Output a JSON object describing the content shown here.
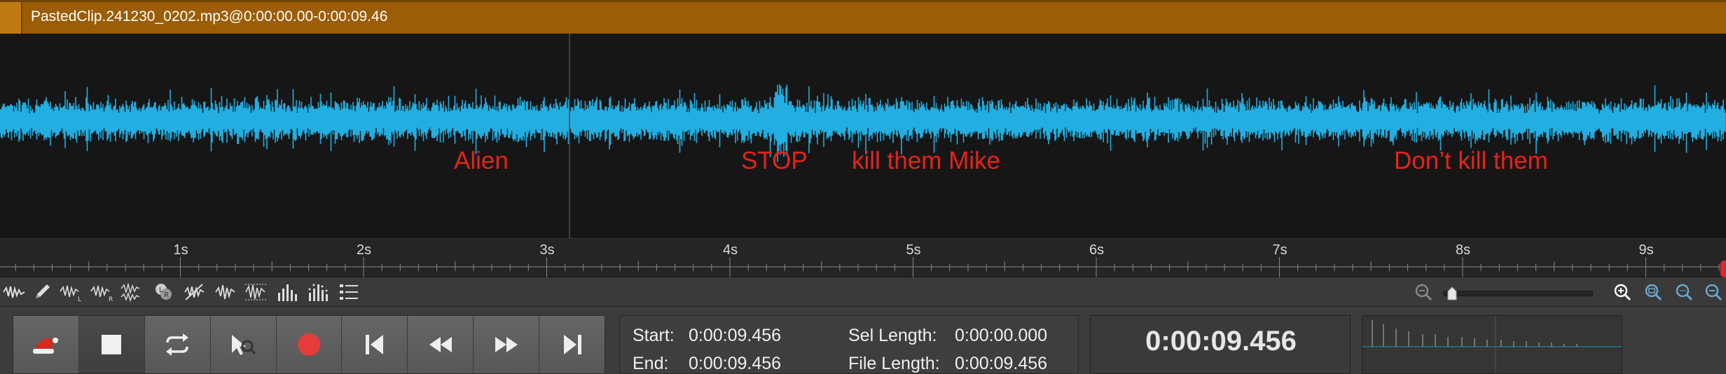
{
  "clip": {
    "title": "PastedClip.241230_0202.mp3@0:00:00.00-0:00:09.46",
    "color": "#9b5d06"
  },
  "waveform": {
    "color": "#22aee0",
    "labels": [
      {
        "text": "Alien"
      },
      {
        "text": "STOP"
      },
      {
        "text": "kill them Mike"
      },
      {
        "text": "Don’t kill them"
      }
    ],
    "label_color": "#e8221a"
  },
  "ruler": {
    "ticks": [
      "1s",
      "2s",
      "3s",
      "4s",
      "5s",
      "6s",
      "7s",
      "8s",
      "9s"
    ]
  },
  "toolbar": {
    "tools": [
      "waveform-view-icon",
      "pencil-icon",
      "spectrum-left-icon",
      "spectrum-right-icon",
      "spectrum-both-icon",
      "channel-lr-icon",
      "noise-icon",
      "waveform-small-icon",
      "waveform-grid-icon",
      "bars-icon",
      "bars-dotted-icon",
      "list-icon"
    ],
    "zoom_level": 0.05
  },
  "transport": {
    "buttons": [
      "santa-hat-play-icon",
      "stop-icon",
      "loop-icon",
      "scrub-icon",
      "record-icon",
      "skip-start-icon",
      "rewind-icon",
      "fast-forward-icon",
      "skip-end-icon"
    ],
    "record_color": "#e53b3b"
  },
  "info": {
    "start_label": "Start:",
    "start_value": "0:00:09.456",
    "end_label": "End:",
    "end_value": "0:00:09.456",
    "sel_length_label": "Sel Length:",
    "sel_length_value": "0:00:00.000",
    "file_length_label": "File Length:",
    "file_length_value": "0:00:09.456"
  },
  "time_display": {
    "current": "0:00:09.456"
  }
}
